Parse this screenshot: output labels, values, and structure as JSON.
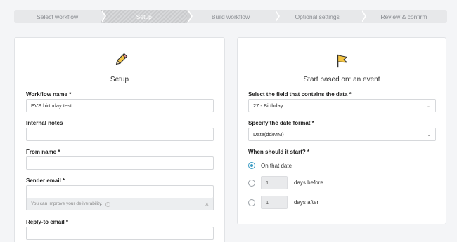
{
  "stepper": {
    "steps": [
      "Select workflow",
      "Setup",
      "Build workflow",
      "Optional settings",
      "Review & confirm"
    ]
  },
  "setup_panel": {
    "icon": "pencil-icon",
    "title": "Setup",
    "workflow_name": {
      "label": "Workflow name *",
      "value": "EVS birthday test"
    },
    "internal_notes": {
      "label": "Internal notes",
      "value": ""
    },
    "from_name": {
      "label": "From name *",
      "value": ""
    },
    "sender_email": {
      "label": "Sender email *",
      "value": "",
      "hint": "You can improve your deliverability."
    },
    "reply_to_email": {
      "label": "Reply-to email *",
      "value": ""
    }
  },
  "event_panel": {
    "icon": "flag-icon",
    "title": "Start based on: an event",
    "field": {
      "label": "Select the field that contains the data *",
      "value": "27 - Birthday"
    },
    "date_format": {
      "label": "Specify the date format *",
      "value": "Date(dd/MM)"
    },
    "when": {
      "label": "When should it start? *",
      "options": [
        {
          "label": "On that date",
          "checked": true
        },
        {
          "value": "1",
          "label": "days before",
          "checked": false
        },
        {
          "value": "1",
          "label": "days after",
          "checked": false
        }
      ]
    }
  },
  "colors": {
    "accent": "#3a9cc4",
    "icon_fill": "#f5c542"
  }
}
